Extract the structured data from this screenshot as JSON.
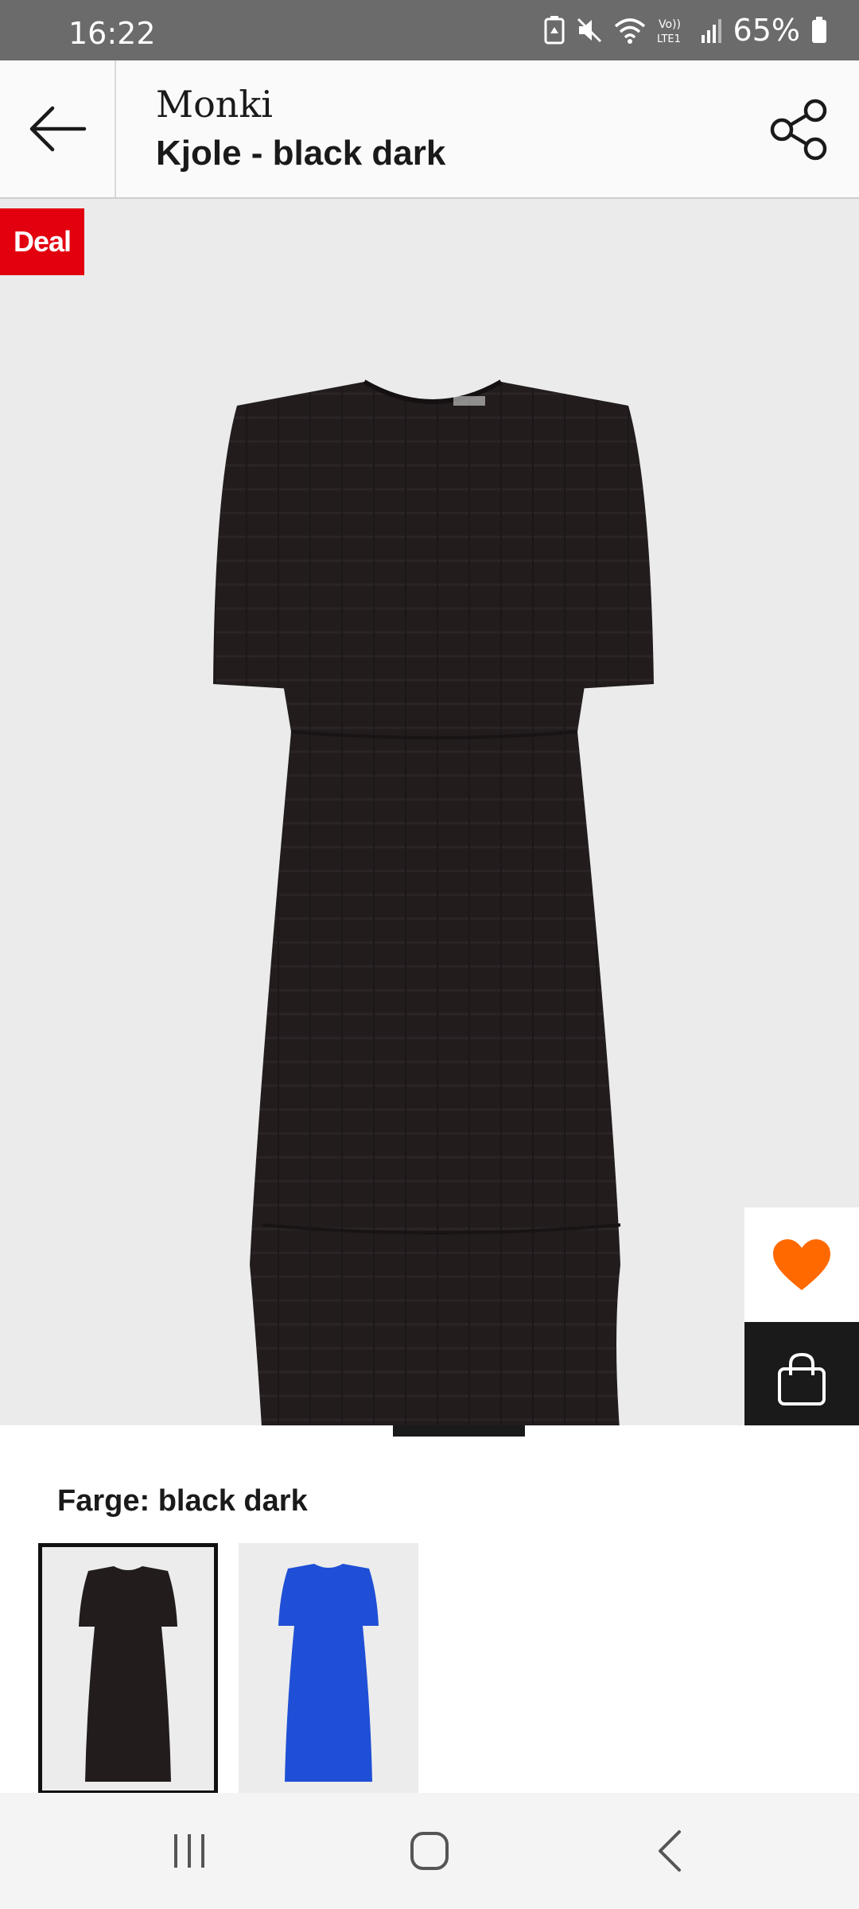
{
  "status_bar": {
    "time": "16:22",
    "battery_percent": "65%",
    "icons": [
      "battery-saver-icon",
      "mute-icon",
      "wifi-icon",
      "volte-icon",
      "signal-icon",
      "battery-icon"
    ]
  },
  "header": {
    "brand": "Monki",
    "title": "Kjole - black dark",
    "back_icon": "arrow-left-icon",
    "share_icon": "share-icon"
  },
  "product": {
    "badge": "Deal",
    "image_icon": "black-dress-image",
    "favorite_icon": "heart-icon",
    "cart_icon": "shopping-bag-icon",
    "carousel_active_index": 2,
    "carousel_count": 3
  },
  "color": {
    "label": "Farge: ",
    "value": "black dark",
    "swatches": [
      {
        "name": "black dark",
        "color": "#211c1c",
        "selected": true
      },
      {
        "name": "blue",
        "color": "#1f4fd6",
        "selected": false
      }
    ]
  },
  "colors": {
    "deal_red": "#e2000f",
    "heart_orange": "#ff6900",
    "dark": "#1a1a1a"
  },
  "nav_bar": {
    "recents_icon": "recents-icon",
    "home_icon": "home-icon",
    "back_icon": "back-chevron-icon"
  }
}
